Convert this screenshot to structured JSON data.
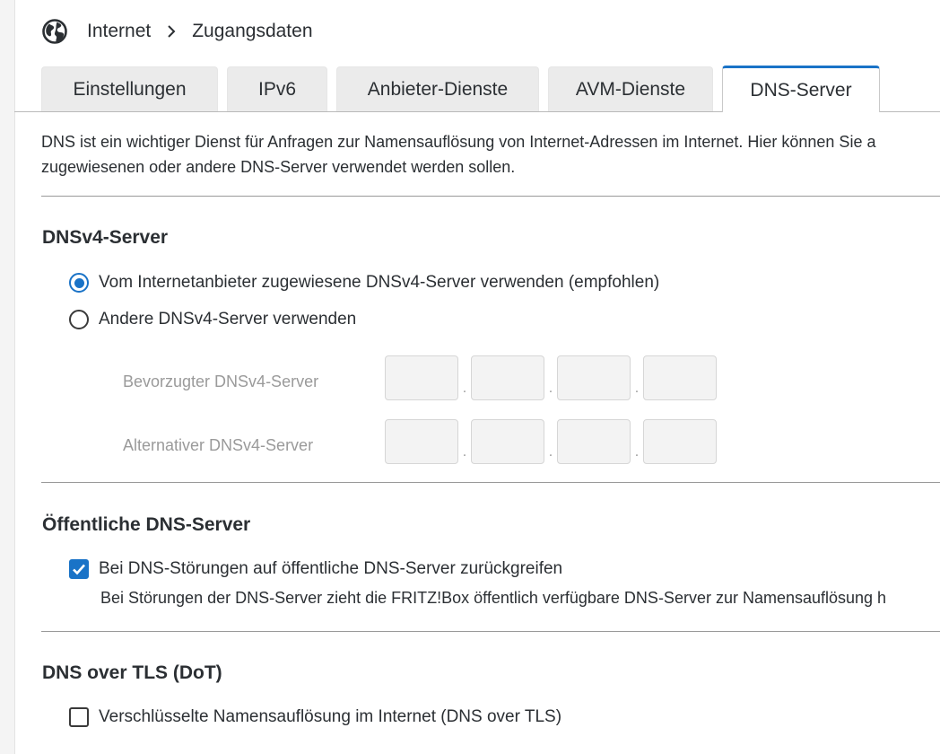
{
  "breadcrumb": {
    "icon": "globe-icon",
    "section": "Internet",
    "page": "Zugangsdaten"
  },
  "tabs": [
    {
      "label": "Einstellungen",
      "active": false
    },
    {
      "label": "IPv6",
      "active": false
    },
    {
      "label": "Anbieter-Dienste",
      "active": false
    },
    {
      "label": "AVM-Dienste",
      "active": false
    },
    {
      "label": "DNS-Server",
      "active": true
    }
  ],
  "intro": {
    "line1": "DNS ist ein wichtiger Dienst für Anfragen zur Namensauflösung von Internet-Adressen im Internet. Hier können Sie a",
    "line2": "zugewiesenen oder andere DNS-Server verwendet werden sollen."
  },
  "dnsv4": {
    "title": "DNSv4-Server",
    "option_provider": {
      "label": "Vom Internetanbieter zugewiesene DNSv4-Server verwenden (empfohlen)",
      "checked": true
    },
    "option_other": {
      "label": "Andere DNSv4-Server verwenden",
      "checked": false
    },
    "preferred_label": "Bevorzugter DNSv4-Server",
    "alternative_label": "Alternativer DNSv4-Server",
    "preferred_octets": [
      "",
      "",
      "",
      ""
    ],
    "alternative_octets": [
      "",
      "",
      "",
      ""
    ],
    "separator": "."
  },
  "public_dns": {
    "title": "Öffentliche DNS-Server",
    "fallback": {
      "label": "Bei DNS-Störungen auf öffentliche DNS-Server zurückgreifen",
      "checked": true
    },
    "hint": "Bei Störungen der DNS-Server zieht die FRITZ!Box öffentlich verfügbare DNS-Server zur Namensauflösung h"
  },
  "dot": {
    "title": "DNS over TLS (DoT)",
    "encrypted": {
      "label": "Verschlüsselte Namensauflösung im Internet (DNS over TLS)",
      "checked": false
    }
  },
  "colors": {
    "accent": "#1a73c7",
    "tab_inactive": "#ebebeb",
    "disabled_text": "#9a9a9a"
  }
}
